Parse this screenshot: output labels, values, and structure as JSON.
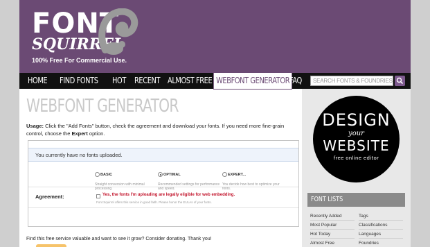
{
  "logo": {
    "font": "FONT",
    "squirrel": "SQUIRREL",
    "tagline": "100% Free For Commercial Use."
  },
  "nav": {
    "items": [
      {
        "label": "HOME"
      },
      {
        "label": "FIND FONTS"
      },
      {
        "label": "HOT"
      },
      {
        "label": "RECENT"
      },
      {
        "label": "ALMOST FREE"
      },
      {
        "label": "WEBFONT GENERATOR"
      },
      {
        "label": "FAQ"
      }
    ],
    "search_placeholder": "SEARCH FONTS & FOUNDRIES"
  },
  "main": {
    "title": "WEBFONT GENERATOR",
    "usage_label": "Usage:",
    "usage_text": " Click the \"Add Fonts\" button, check the agreement and download your fonts. If you need more fine-grain control, choose the ",
    "usage_expert": "Expert",
    "usage_end": " option.",
    "no_fonts_msg": "You currently have no fonts uploaded.",
    "options": [
      {
        "label": "BASIC",
        "desc": "Straight conversion with minimal processing.",
        "checked": false
      },
      {
        "label": "OPTIMAL",
        "desc": "Recommended settings for performance and speed.",
        "checked": true
      },
      {
        "label": "EXPERT...",
        "desc": "You decide how best to optimize your fonts.",
        "checked": false
      }
    ],
    "agreement_label": "Agreement:",
    "agreement_text": "Yes, the fonts I'm uploading are legally eligible for web embedding.",
    "agreement_sub": "Font Squirrel offers this service in good faith. Please honor the EULAs of your fonts.",
    "donate_text": "Find this free service valuable and want to see it grow? Consider donating. Thank you!"
  },
  "sidebar": {
    "ad_design": "DESIGN",
    "ad_your": "your",
    "ad_website": "WEBSITE",
    "ad_free": "free online editor",
    "font_lists_title": "FONT LISTS",
    "font_lists": [
      [
        "Recently Added",
        "Tags"
      ],
      [
        "Most Popular",
        "Classifications"
      ],
      [
        "Hot Today",
        "Languages"
      ],
      [
        "Almost Free",
        "Foundries"
      ]
    ]
  },
  "colors": {
    "brand_purple": "#6b4a74",
    "nav_black": "#111111",
    "agreement_red": "#c3162d",
    "sidebar_bg": "#e8e8e8"
  }
}
